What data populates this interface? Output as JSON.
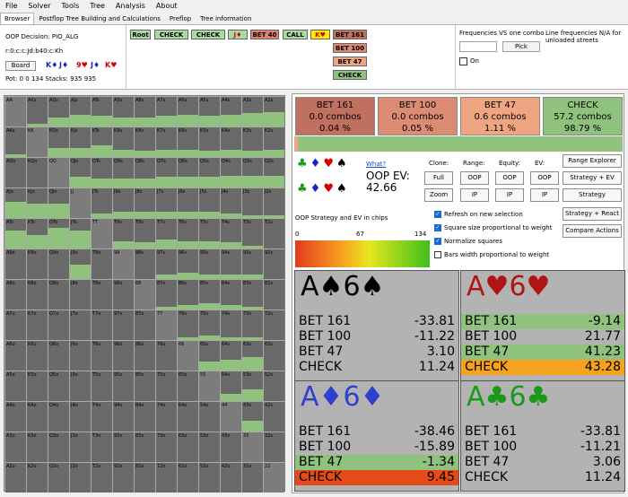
{
  "menu": [
    "File",
    "Solver",
    "Tools",
    "Tree",
    "Analysis",
    "About"
  ],
  "tabs": [
    "Browser",
    "Postflop Tree Building and Calculations",
    "Preflop",
    "Tree information"
  ],
  "decision": {
    "label": "OOP Decision:",
    "value": "PIO_ALG",
    "path": "r:0:c:c:Jd:b40:c:Kh",
    "pot": "Pot: 0 0 134 Stacks: 935 935",
    "board_button": "Board"
  },
  "board_cards": [
    {
      "text": "K♦",
      "color": "blue"
    },
    {
      "text": "J♦",
      "color": "blue"
    },
    {
      "text": "9♥",
      "color": "red"
    },
    {
      "text": "J♦",
      "color": "blue"
    },
    {
      "text": "K♥",
      "color": "red"
    }
  ],
  "tree_buttons": {
    "row1": [
      "Root",
      "CHECK",
      "CHECK",
      "J♦",
      "BET 40",
      "CALL",
      "K♥"
    ],
    "col": [
      "BET 161",
      "BET 100",
      "BET 47",
      "CHECK"
    ]
  },
  "freq": {
    "title": "Frequencies VS one combo",
    "pick": "Pick",
    "on": "On",
    "line_freq": "Line frequencies N/A for unloaded streets"
  },
  "actions": [
    {
      "name": "BET 161",
      "combos": "0.0 combos",
      "pct": "0.04 %",
      "color": "#c0705f"
    },
    {
      "name": "BET 100",
      "combos": "0.0 combos",
      "pct": "0.05 %",
      "color": "#dc8c73"
    },
    {
      "name": "BET 47",
      "combos": "0.6 combos",
      "pct": "1.11 %",
      "color": "#f0a582"
    },
    {
      "name": "CHECK",
      "combos": "57.2 combos",
      "pct": "98.79 %",
      "color": "#8fc27d"
    }
  ],
  "action_bar": [
    {
      "frac": 0.0004,
      "color": "#c0705f"
    },
    {
      "frac": 0.0005,
      "color": "#dc8c73"
    },
    {
      "frac": 0.0111,
      "color": "#f0a582"
    },
    {
      "frac": 0.9879,
      "color": "#8fc27d"
    }
  ],
  "info": {
    "what": "What?",
    "oop_ev_label": "OOP EV:",
    "oop_ev": "42.66",
    "clone": "Clone:",
    "range": "Range:",
    "equity": "Equity:",
    "ev": "EV:",
    "full": "Full",
    "zoom": "Zoom",
    "oop": "OOP",
    "ip": "IP",
    "strat_label": "OOP Strategy and EV in chips",
    "g0": "0",
    "g1": "67",
    "g2": "134"
  },
  "suits_row1": [
    {
      "s": "♣",
      "c": "green"
    },
    {
      "s": "♦",
      "c": "blue"
    },
    {
      "s": "♥",
      "c": "red"
    },
    {
      "s": "♠",
      "c": "black"
    }
  ],
  "suits_row2": [
    {
      "s": "♣",
      "c": "green"
    },
    {
      "s": "♦",
      "c": "blue"
    },
    {
      "s": "♥",
      "c": "red"
    },
    {
      "s": "♠",
      "c": "black"
    }
  ],
  "side_buttons": [
    "Range Explorer",
    "Strategy + EV",
    "Strategy",
    "Strategy + React",
    "Compare Actions"
  ],
  "checkboxes": [
    {
      "label": "Refresh on new selection",
      "on": true
    },
    {
      "label": "Square size proportional to weight",
      "on": true
    },
    {
      "label": "Normalize squares",
      "on": true
    },
    {
      "label": "Bars width proportional to weight",
      "on": false
    }
  ],
  "combos": [
    {
      "rank": "A",
      "suit": "♠",
      "rank2": "6",
      "suit2": "♠",
      "color": "#000000",
      "rows": [
        [
          "BET 161",
          "-33.81",
          ""
        ],
        [
          "BET 100",
          "-11.22",
          ""
        ],
        [
          "BET 47",
          "3.10",
          ""
        ],
        [
          "CHECK",
          "11.24",
          ""
        ]
      ]
    },
    {
      "rank": "A",
      "suit": "♥",
      "rank2": "6",
      "suit2": "♥",
      "color": "#b01515",
      "rows": [
        [
          "BET 161",
          "-9.14",
          "#8fc27d"
        ],
        [
          "BET 100",
          "21.77",
          ""
        ],
        [
          "BET 47",
          "41.23",
          "#8fc27d"
        ],
        [
          "CHECK",
          "43.28",
          "#f7a21f"
        ]
      ]
    },
    {
      "rank": "A",
      "suit": "♦",
      "rank2": "6",
      "suit2": "♦",
      "color": "#2f3fd0",
      "rows": [
        [
          "BET 161",
          "-38.46",
          ""
        ],
        [
          "BET 100",
          "-15.89",
          ""
        ],
        [
          "BET 47",
          "-1.34",
          "#8fc27d"
        ],
        [
          "CHECK",
          "9.45",
          "#e64a19"
        ]
      ]
    },
    {
      "rank": "A",
      "suit": "♣",
      "rank2": "6",
      "suit2": "♣",
      "color": "#1a9a1a",
      "rows": [
        [
          "BET 161",
          "-33.81",
          ""
        ],
        [
          "BET 100",
          "-11.21",
          ""
        ],
        [
          "BET 47",
          "3.06",
          ""
        ],
        [
          "CHECK",
          "11.24",
          ""
        ]
      ]
    }
  ],
  "matrix_ranks": [
    "A",
    "K",
    "Q",
    "J",
    "T",
    "9",
    "8",
    "7",
    "6",
    "5",
    "4",
    "3",
    "2"
  ]
}
